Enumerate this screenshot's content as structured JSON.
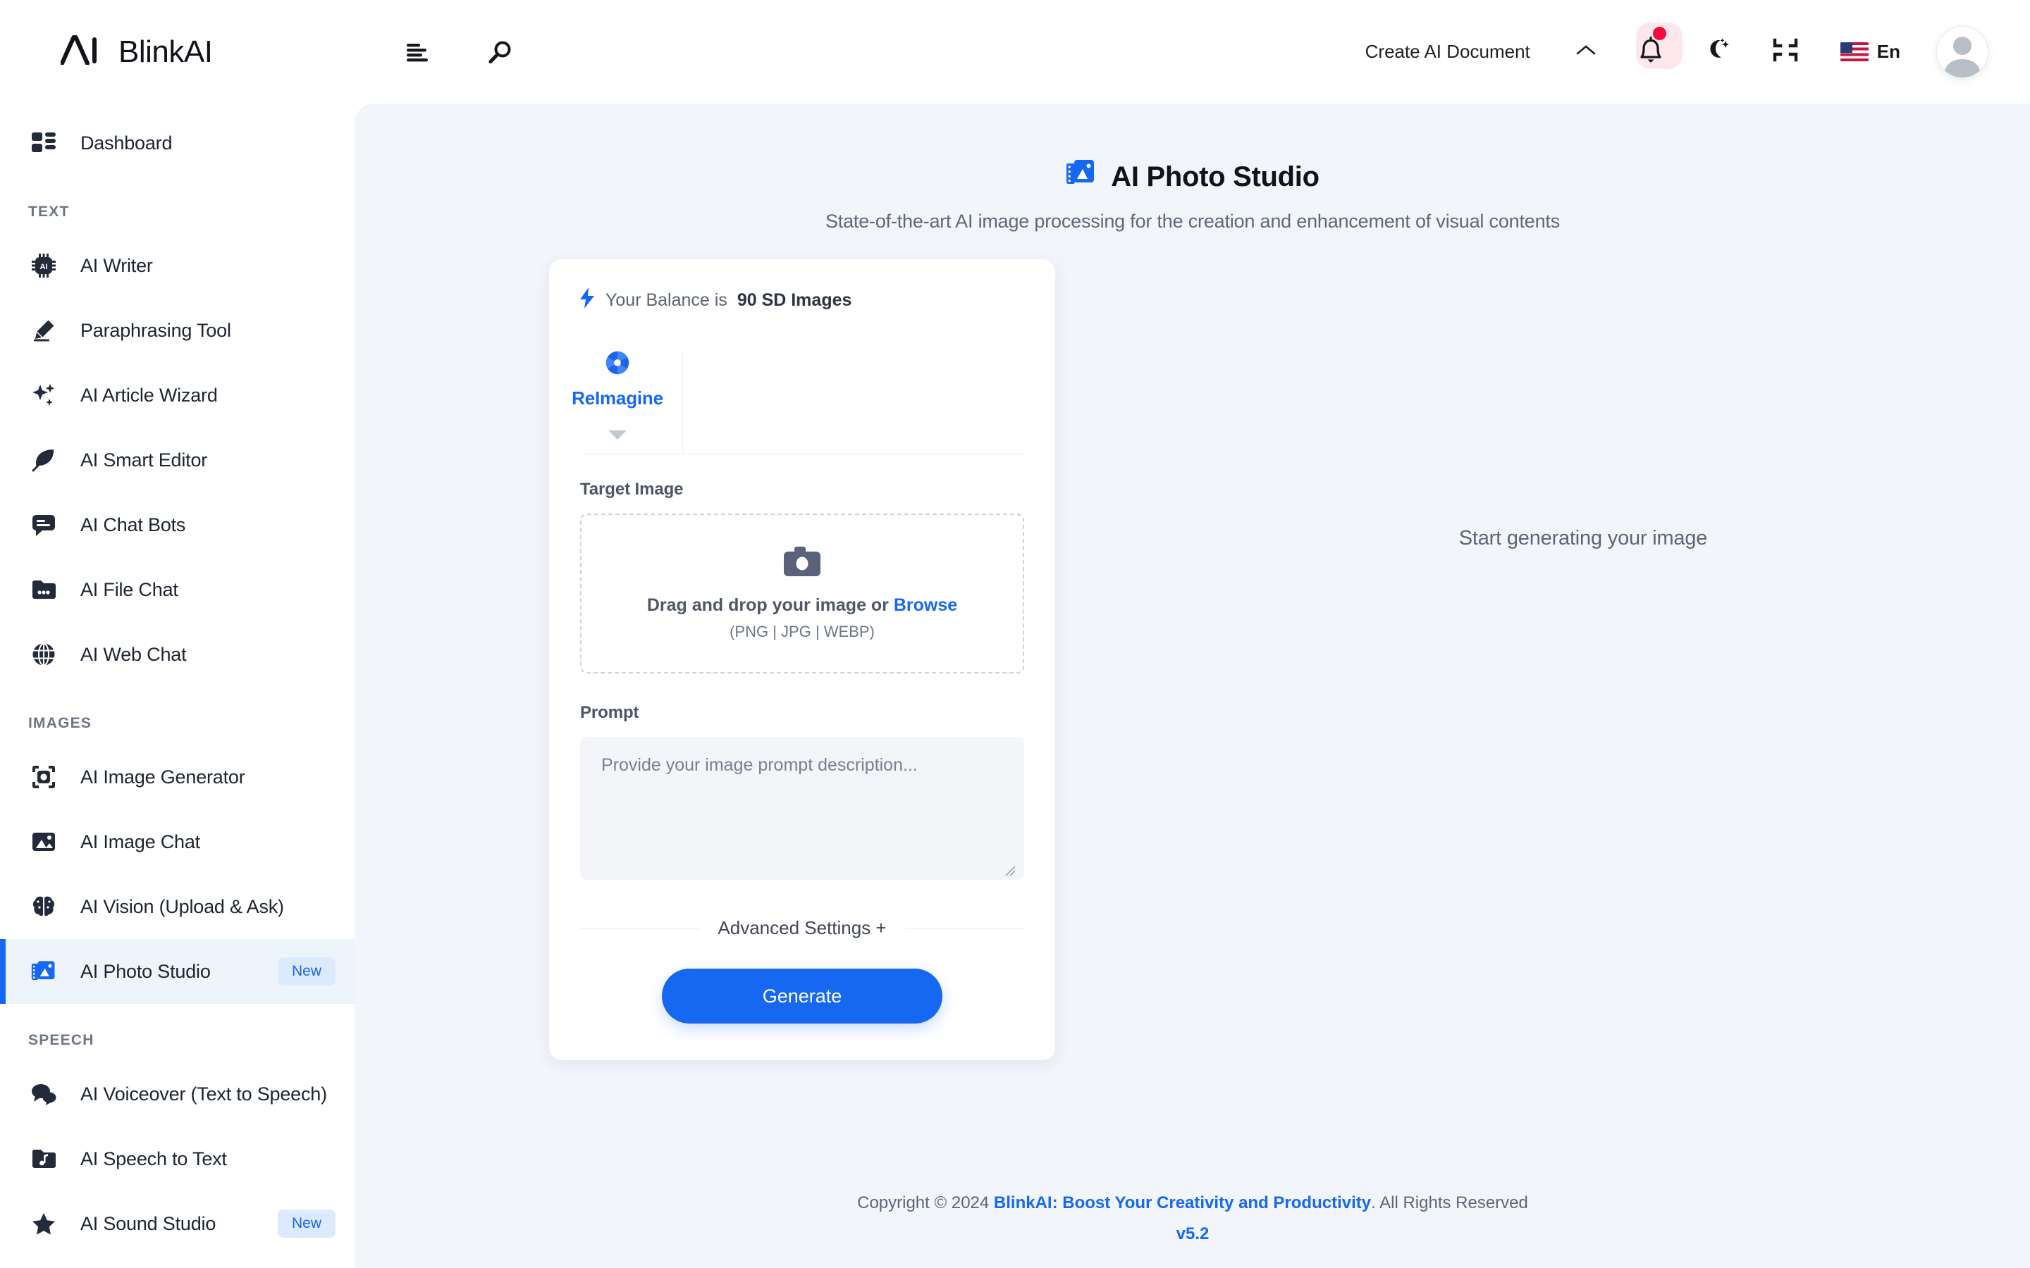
{
  "brand": {
    "name": "BlinkAI",
    "mark": "ai-logomark"
  },
  "topbar": {
    "menu_icon": "menu-icon",
    "search_icon": "search-icon",
    "create_document_label": "Create AI Document",
    "chevron_icon": "chevron-up-icon",
    "notification_icon": "bell-icon",
    "theme_icon": "moon-icon",
    "fullscreen_icon": "compress-icon",
    "language_label": "En",
    "language_flag": "us-flag-icon",
    "avatar_icon": "user-avatar"
  },
  "sidebar": {
    "items": [
      {
        "label": "Dashboard",
        "icon": "dashboard-icon",
        "active": false,
        "badge": ""
      }
    ],
    "groups": [
      {
        "title": "TEXT",
        "items": [
          {
            "label": "AI Writer",
            "icon": "chip-ai-icon",
            "active": false,
            "badge": ""
          },
          {
            "label": "Paraphrasing Tool",
            "icon": "pencil-icon",
            "active": false,
            "badge": ""
          },
          {
            "label": "AI Article Wizard",
            "icon": "sparkles-icon",
            "active": false,
            "badge": ""
          },
          {
            "label": "AI Smart Editor",
            "icon": "feather-icon",
            "active": false,
            "badge": ""
          },
          {
            "label": "AI Chat Bots",
            "icon": "chat-bubble-icon",
            "active": false,
            "badge": ""
          },
          {
            "label": "AI File Chat",
            "icon": "folder-dots-icon",
            "active": false,
            "badge": ""
          },
          {
            "label": "AI Web Chat",
            "icon": "globe-icon",
            "active": false,
            "badge": ""
          }
        ]
      },
      {
        "title": "IMAGES",
        "items": [
          {
            "label": "AI Image Generator",
            "icon": "image-scan-icon",
            "active": false,
            "badge": ""
          },
          {
            "label": "AI Image Chat",
            "icon": "photo-icon",
            "active": false,
            "badge": ""
          },
          {
            "label": "AI Vision (Upload & Ask)",
            "icon": "brain-icon",
            "active": false,
            "badge": ""
          },
          {
            "label": "AI Photo Studio",
            "icon": "photo-studio-icon",
            "active": true,
            "badge": "New"
          }
        ]
      },
      {
        "title": "SPEECH",
        "items": [
          {
            "label": "AI Voiceover (Text to Speech)",
            "icon": "speech-bubbles-icon",
            "active": false,
            "badge": ""
          },
          {
            "label": "AI Speech to Text",
            "icon": "music-folder-icon",
            "active": false,
            "badge": ""
          },
          {
            "label": "AI Sound Studio",
            "icon": "star-icon",
            "active": false,
            "badge": "New"
          }
        ]
      }
    ]
  },
  "page": {
    "title": "AI Photo Studio",
    "title_icon": "photo-studio-icon",
    "subtitle": "State-of-the-art AI image processing for the creation and enhancement of visual contents"
  },
  "card": {
    "balance_prefix": "Your Balance is",
    "balance_value": "90 SD Images",
    "balance_icon": "lightning-icon",
    "tabs": [
      {
        "label": "ReImagine",
        "icon": "aperture-icon",
        "active": true
      }
    ],
    "target_image_label": "Target Image",
    "dropzone": {
      "icon": "camera-icon",
      "text_lead": "Drag and drop your image or",
      "browse_label": "Browse",
      "formats": "(PNG | JPG | WEBP)"
    },
    "prompt_label": "Prompt",
    "prompt_placeholder": "Provide your image prompt description...",
    "prompt_value": "",
    "advanced_settings_label": "Advanced Settings +",
    "generate_label": "Generate"
  },
  "preview": {
    "empty_message": "Start generating your image"
  },
  "footer": {
    "copyright_prefix": "Copyright © 2024",
    "link_text": "BlinkAI: Boost Your Creativity and Productivity",
    "copyright_suffix": ". All Rights Reserved",
    "version": "v5.2"
  },
  "colors": {
    "accent": "#1668f3",
    "badge_bg": "#dceafd",
    "main_bg": "#f2f5fa",
    "notification_dot": "#f6093c"
  }
}
